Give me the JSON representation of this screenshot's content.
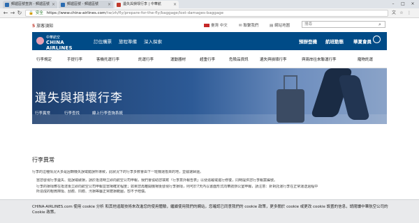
{
  "browser": {
    "tabs": [
      {
        "title": "郵遞區號查詢 - 郵遞區號"
      },
      {
        "title": "郵遞區號 - 郵遞區號"
      },
      {
        "title": "遺失與損壞行李 | 中華航"
      }
    ],
    "secure_label": "安全",
    "url_host": "https://www.china-airlines.com",
    "url_path": "/tw/zh/fly/prepare-for-the-fly/baggage/lost-damages-baggage"
  },
  "header": {
    "notice_count": "5",
    "notice_label": "旅客須知",
    "language": "臺灣 中文",
    "contact": "聯繫我們",
    "newsletter": "網站地圖",
    "search_placeholder": "搜尋"
  },
  "brand": {
    "chinese": "中華航空",
    "english": "CHINA AIRLINES"
  },
  "main_nav": {
    "left": [
      "訂位購票",
      "旅程準備",
      "深入探索"
    ],
    "right": [
      "預辦登機",
      "航班動態",
      "華夏會員"
    ]
  },
  "sub_nav": [
    "行李規定",
    "手提行李",
    "客機托運行李",
    "託運行李",
    "運動器材",
    "超重行李",
    "危險品資訊",
    "遺失與損壞行李",
    "與兩岸往來聯運行李",
    "寵物託運"
  ],
  "hero": {
    "title": "遺失與損壞行李",
    "tabs": [
      "行李異常",
      "行李查找",
      "線上行李查詢系統"
    ]
  },
  "content": {
    "section_title": "行李異常",
    "intro": "行李的這種情況大多是因轉機失誤或錯誤所導致，此狀況下的行李多數會由下一班機運抵目的地，並儘速歸還。",
    "bullets": [
      "當您發現行李遺失、延誤或破損，請於抵達時立即向航空公司申報，我們會協助您填寫「行李意外報告表」以便追蹤或進行修復，同時提供您行李報案編號。",
      "行李的損壞應在抵達後立即向航空公司申報並當場確定程度；如果您再離開機場後發現行李損壞，則可於7天內以書面形式向華航辦公室申報，請注意：針對託運行李在正常運送過程中",
      "所造成的輕微擦傷、刮痕、凹痕、污損等屬正常磨損範圍，恕不予賠償。"
    ]
  },
  "cookie": {
    "text": "CHINA-AIRLINES.com 使用 cookie 分析 和其他追蹤技術來改進您的使用體驗，繼續使用我們的網站，您確認已同意我們的 cookie 政策，更多關於 cookie 或更改 cookie 設置的信息，請閱讀中華航空公司的 Cookie 政策。"
  }
}
